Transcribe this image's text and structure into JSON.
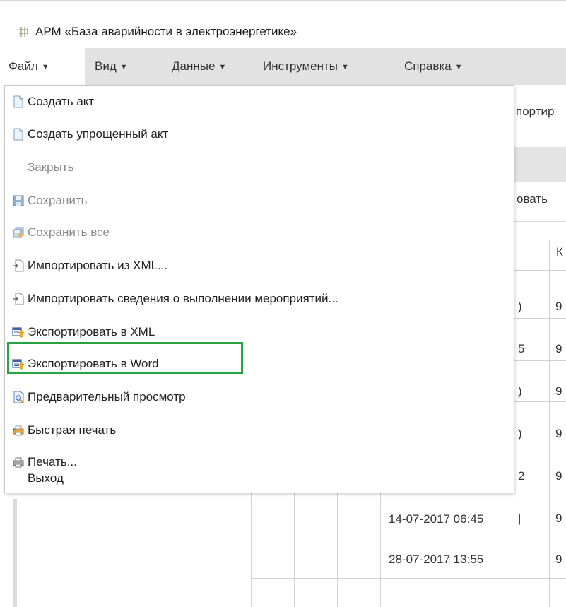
{
  "window": {
    "title": "АРМ «База аварийности в электроэнергетике»"
  },
  "menubar": {
    "items": [
      {
        "label": "Файл"
      },
      {
        "label": "Вид"
      },
      {
        "label": "Данные"
      },
      {
        "label": "Инструменты"
      },
      {
        "label": "Справка"
      }
    ]
  },
  "file_menu": {
    "items": [
      {
        "label": "Создать акт",
        "icon": "document-icon",
        "enabled": true
      },
      {
        "label": "Создать упрощенный акт",
        "icon": "document-icon",
        "enabled": true
      },
      {
        "label": "Закрыть",
        "icon": "",
        "enabled": false
      },
      {
        "label": "Сохранить",
        "icon": "floppy-disk-icon",
        "enabled": false
      },
      {
        "label": "Сохранить все",
        "icon": "save-all-icon",
        "enabled": false
      },
      {
        "label": "Импортировать из XML...",
        "icon": "import-icon",
        "enabled": true
      },
      {
        "label": "Импортировать сведения о выполнении мероприятий...",
        "icon": "import-icon",
        "enabled": true
      },
      {
        "label": "Экспортировать в XML",
        "icon": "export-icon",
        "enabled": true
      },
      {
        "label": "Экспортировать в Word",
        "icon": "export-icon",
        "enabled": true,
        "highlighted": true
      },
      {
        "label": "Предварительный просмотр",
        "icon": "print-preview-icon",
        "enabled": true
      },
      {
        "label": "Быстрая печать",
        "icon": "quick-print-icon",
        "enabled": true
      },
      {
        "label": "Печать...",
        "icon": "printer-icon",
        "enabled": true
      },
      {
        "label": "Выход",
        "icon": "",
        "enabled": true
      }
    ]
  },
  "background": {
    "toolbar_partial": "портир",
    "toolbar2_partial": "овать",
    "column_header_partial": "К",
    "time_partials": [
      ")",
      "5",
      ")",
      ")",
      "2",
      "|"
    ],
    "column_partial_value": "9",
    "rows": [
      {
        "datetime": "14-07-2017 06:45",
        "value": "9"
      },
      {
        "datetime": "28-07-2017 13:55",
        "value": "9"
      }
    ]
  },
  "colors": {
    "highlight": "#27a344",
    "menubar_bg": "#e2e2e2"
  }
}
